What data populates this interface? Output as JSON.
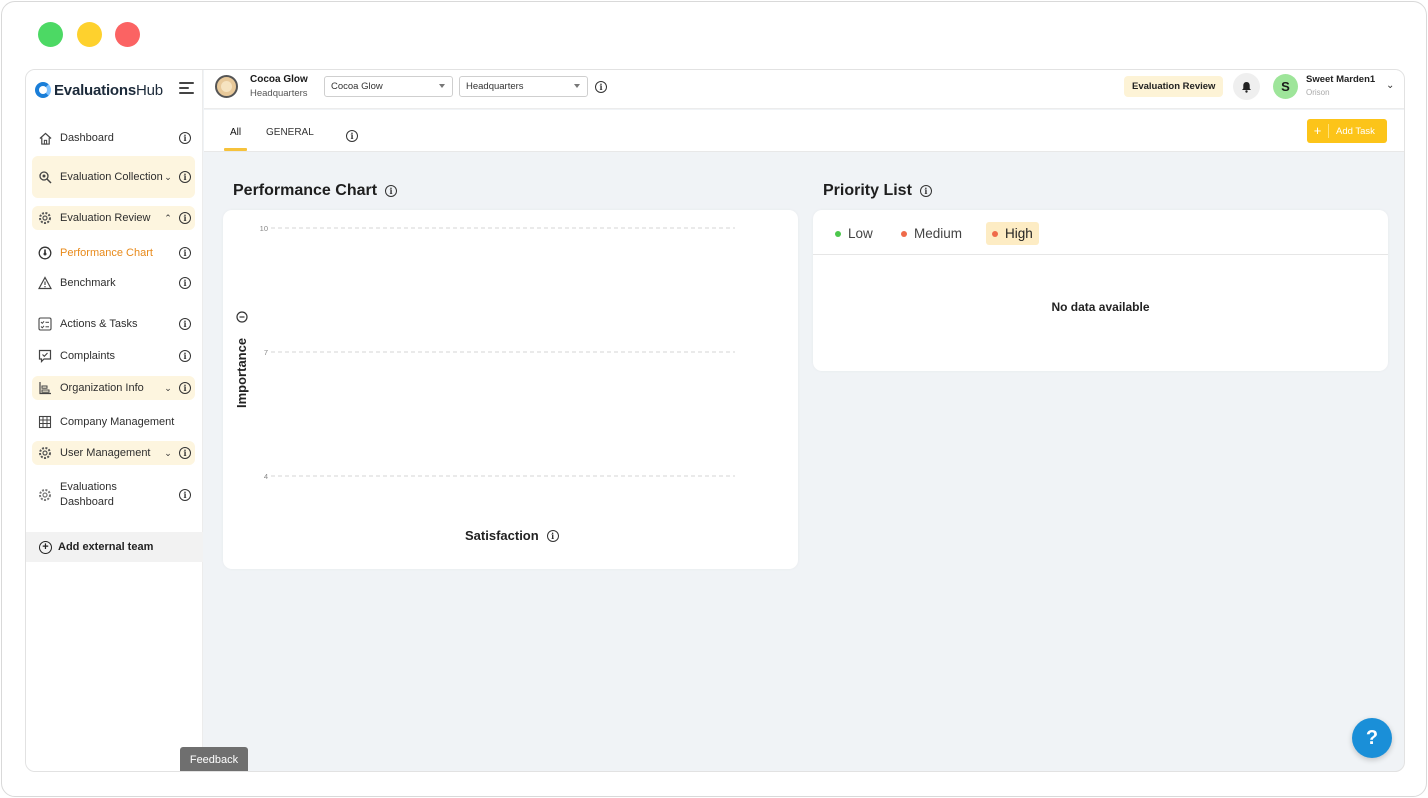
{
  "window": {
    "traffic_lights": [
      "#4cd964",
      "#fed12d",
      "#fb6363"
    ]
  },
  "app": {
    "logo_text_bold": "Evaluations",
    "logo_text_rest": "Hub",
    "brand_color": "#1a7ed8"
  },
  "sidebar": {
    "items": [
      {
        "label": "Dashboard",
        "icon": "home-icon"
      },
      {
        "label": "Evaluation Collection",
        "icon": "search-gear-icon",
        "expandable": true,
        "expanded": false
      },
      {
        "label": "Evaluation Review",
        "icon": "gear-icon",
        "expandable": true,
        "expanded": true
      },
      {
        "label": "Performance Chart",
        "icon": "gauge-icon",
        "active": true
      },
      {
        "label": "Benchmark",
        "icon": "warning-triangle-icon"
      },
      {
        "label": "Actions & Tasks",
        "icon": "checklist-icon"
      },
      {
        "label": "Complaints",
        "icon": "chat-alert-icon"
      },
      {
        "label": "Organization Info",
        "icon": "org-chart-icon",
        "expandable": true
      },
      {
        "label": "Company Management",
        "icon": "building-icon"
      },
      {
        "label": "User Management",
        "icon": "gear-icon",
        "expandable": true
      },
      {
        "label": "Evaluations Dashboard",
        "icon": "gear-icon"
      }
    ],
    "add_team_label": "Add external team",
    "feedback_label": "Feedback"
  },
  "topbar": {
    "company_name": "Cocoa Glow",
    "company_location": "Headquarters",
    "company_select": "Cocoa Glow",
    "location_select": "Headquarters",
    "module_badge": "Evaluation Review",
    "user_initial": "S",
    "user_name": "Sweet Marden1",
    "user_org": "Orison",
    "accent_color": "#fcc419"
  },
  "tabs": {
    "items": [
      "All",
      "GENERAL"
    ],
    "active": "All",
    "add_task_label": "Add Task"
  },
  "performance": {
    "title": "Performance Chart",
    "chart_data": {
      "type": "scatter",
      "title": "Performance Chart",
      "xlabel": "Satisfaction",
      "ylabel": "Importance",
      "y_ticks": [
        10,
        7,
        4
      ],
      "ylim": [
        4,
        10
      ],
      "points": [],
      "grid": "horizontal dashed"
    }
  },
  "priority": {
    "title": "Priority List",
    "tabs": [
      {
        "label": "Low",
        "color": "#4cc74c"
      },
      {
        "label": "Medium",
        "color": "#ef6a4a"
      },
      {
        "label": "High",
        "color": "#ef6a4a"
      }
    ],
    "active_tab": "High",
    "empty_text": "No data available"
  },
  "help_label": "?"
}
